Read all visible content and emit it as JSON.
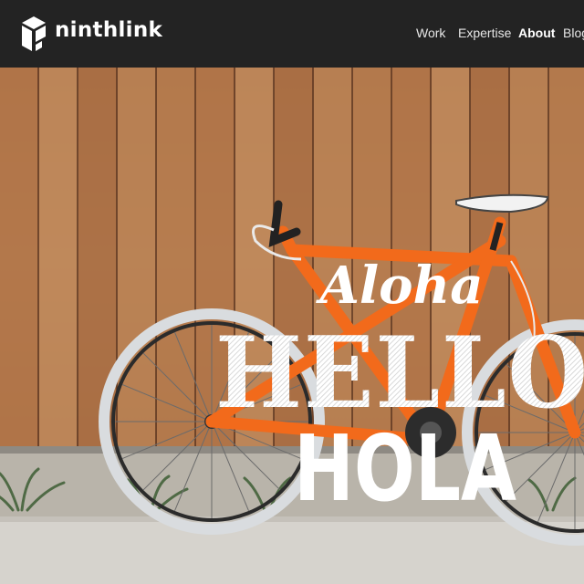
{
  "brand": {
    "name": "ninthlink",
    "logo_icon": "cube-logo-icon"
  },
  "nav": {
    "items": [
      {
        "label": "Work",
        "active": false
      },
      {
        "label": "Expertise",
        "active": false
      },
      {
        "label": "About",
        "active": true
      },
      {
        "label": "Blog",
        "active": false
      }
    ]
  },
  "hero": {
    "greetings": [
      "Aloha",
      "HELLO",
      "HOLA"
    ]
  },
  "colors": {
    "header_bg": "#232323",
    "bike_frame": "#f26a1b",
    "wood": "#b87a4e"
  }
}
